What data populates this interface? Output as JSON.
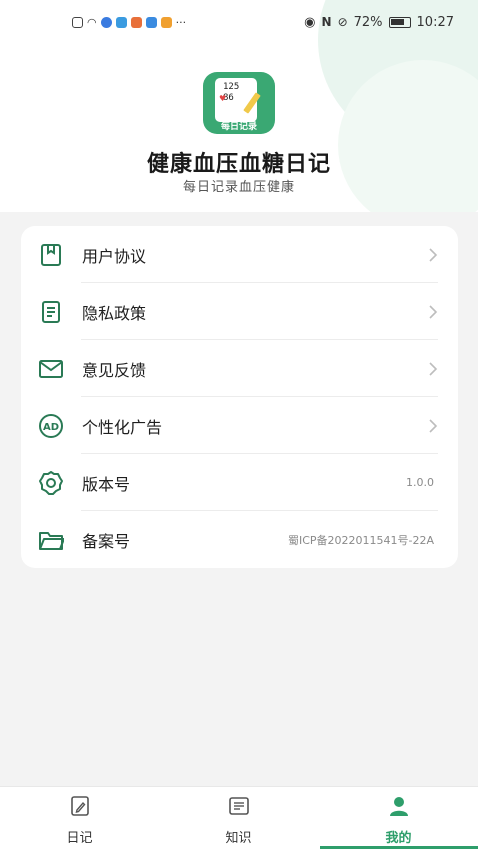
{
  "status_bar": {
    "battery": "72%",
    "time": "10:27"
  },
  "app": {
    "icon_numbers": [
      "125",
      "86"
    ],
    "icon_label": "每日记录",
    "title": "健康血压血糖日记",
    "subtitle": "每日记录血压健康"
  },
  "menu": {
    "items": [
      {
        "label": "用户协议",
        "icon": "bookmark-doc-icon",
        "value": ""
      },
      {
        "label": "隐私政策",
        "icon": "document-icon",
        "value": ""
      },
      {
        "label": "意见反馈",
        "icon": "envelope-icon",
        "value": ""
      },
      {
        "label": "个性化广告",
        "icon": "ad-icon",
        "value": ""
      },
      {
        "label": "版本号",
        "icon": "gear-icon",
        "value": "1.0.0"
      },
      {
        "label": "备案号",
        "icon": "folder-icon",
        "value": "蜀ICP备2022011541号-22A"
      }
    ]
  },
  "tabs": [
    {
      "label": "日记",
      "icon": "diary-icon",
      "active": false
    },
    {
      "label": "知识",
      "icon": "knowledge-icon",
      "active": false
    },
    {
      "label": "我的",
      "icon": "person-icon",
      "active": true
    }
  ],
  "colors": {
    "accent": "#2e9e6b",
    "icon_green": "#3aa873",
    "background": "#f3f3f3"
  }
}
